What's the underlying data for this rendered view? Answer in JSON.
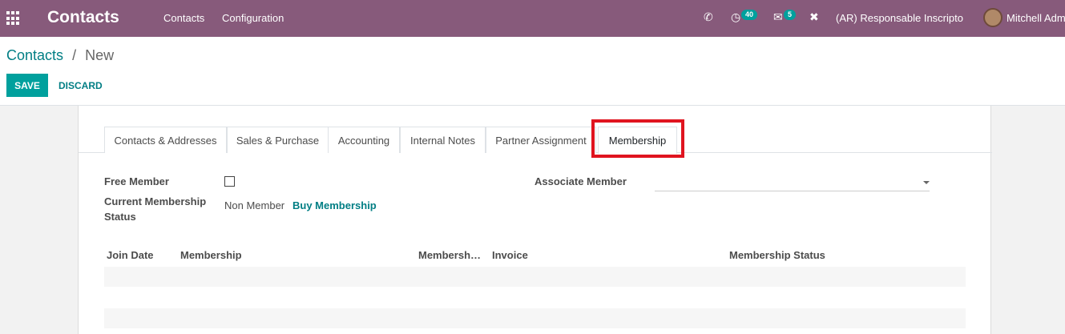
{
  "navbar": {
    "brand": "Contacts",
    "menu": [
      "Contacts",
      "Configuration"
    ],
    "activity_count": "40",
    "message_count": "5",
    "company": "(AR) Responsable Inscripto",
    "user": "Mitchell Admin"
  },
  "control": {
    "breadcrumb_parent": "Contacts",
    "breadcrumb_separator": "/",
    "breadcrumb_current": "New",
    "save_label": "SAVE",
    "discard_label": "DISCARD"
  },
  "tabs": [
    "Contacts & Addresses",
    "Sales & Purchase",
    "Accounting",
    "Internal Notes",
    "Partner Assignment",
    "Membership"
  ],
  "form": {
    "free_member_label": "Free Member",
    "current_status_label_line1": "Current Membership",
    "current_status_label_line2": "Status",
    "current_status_value": "Non Member",
    "buy_membership_label": "Buy Membership",
    "associate_member_label": "Associate Member",
    "associate_member_value": ""
  },
  "table": {
    "columns": [
      "Join Date",
      "Membership",
      "Membersh…",
      "Invoice",
      "Membership Status"
    ]
  },
  "colors": {
    "navbar": "#875a7b",
    "primary": "#00a09d",
    "link": "#017e84",
    "highlight": "#e0141f"
  }
}
